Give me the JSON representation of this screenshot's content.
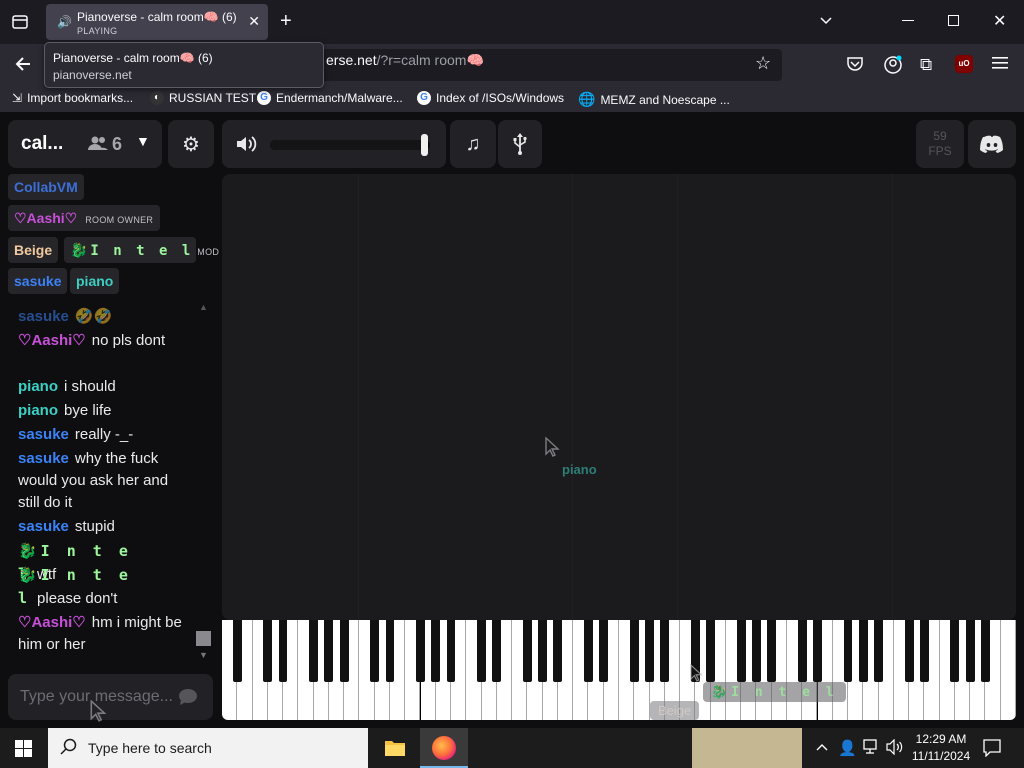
{
  "browser": {
    "tab": {
      "title": "Pianoverse - calm room🧠 (6)",
      "status": "PLAYING"
    },
    "tooltip": {
      "title": "Pianoverse - calm room🧠 (6)",
      "host": "pianoverse.net"
    },
    "url": {
      "visible": "erse.net",
      "query": "/?r=calm room🧠"
    },
    "bookmarks": [
      {
        "label": "Import bookmarks...",
        "icon": "import-icon"
      },
      {
        "label": "RUSSIAN TEST",
        "icon": "site-icon"
      },
      {
        "label": "Endermanch/Malware...",
        "icon": "google-icon"
      },
      {
        "label": "Index of /ISOs/Windows",
        "icon": "google-icon"
      },
      {
        "label": "MEMZ and Noescape ...",
        "icon": "globe-icon"
      }
    ]
  },
  "room": {
    "name": "cal...",
    "user_count": "6"
  },
  "toolbar": {
    "fps_value": "59",
    "fps_label": "FPS",
    "volume_level": 0.96
  },
  "users": [
    {
      "name": "CollabVM",
      "color": "#3b6fd6",
      "badge": ""
    },
    {
      "name": "♡Aashi♡",
      "color": "#c84fd8",
      "badge": "ROOM OWNER"
    },
    {
      "name": "Beige",
      "color": "#f0c89e",
      "badge": ""
    },
    {
      "name": "🐉I n t e l",
      "color": "#9cf59c",
      "badge": "MOD"
    },
    {
      "name": "sasuke",
      "color": "#3b82f6",
      "badge": ""
    },
    {
      "name": "piano",
      "color": "#3ccfc4",
      "badge": ""
    }
  ],
  "chat": [
    {
      "user": "sasuke",
      "color": "#3b82f6",
      "text": "🤣🤣"
    },
    {
      "user": "♡Aashi♡",
      "color": "#c84fd8",
      "text": "no pls dont"
    },
    {
      "user": "piano",
      "color": "#3ccfc4",
      "text": "i should"
    },
    {
      "user": "piano",
      "color": "#3ccfc4",
      "text": "bye life"
    },
    {
      "user": "sasuke",
      "color": "#3b82f6",
      "text": "really -_-"
    },
    {
      "user": "sasuke",
      "color": "#3b82f6",
      "text": "why the fuck would you ask her and still do it"
    },
    {
      "user": "sasuke",
      "color": "#3b82f6",
      "text": "stupid"
    },
    {
      "user": "🐉I n t e l",
      "color": "#9cf59c",
      "text": "wtf"
    },
    {
      "user": "🐉I n t e l",
      "color": "#9cf59c",
      "text": "please don't"
    },
    {
      "user": "♡Aashi♡",
      "color": "#c84fd8",
      "text": "hm i might be him or her"
    }
  ],
  "chat_input": {
    "placeholder": "Type your message..."
  },
  "cursors": [
    {
      "name": "piano",
      "color": "#3ccfc4"
    },
    {
      "name": "Beige",
      "color": "#f0c89e"
    },
    {
      "name": "🐉I n t e l",
      "color": "#9cf59c"
    }
  ],
  "taskbar": {
    "search_placeholder": "Type here to search",
    "time": "12:29 AM",
    "date": "11/11/2024"
  }
}
